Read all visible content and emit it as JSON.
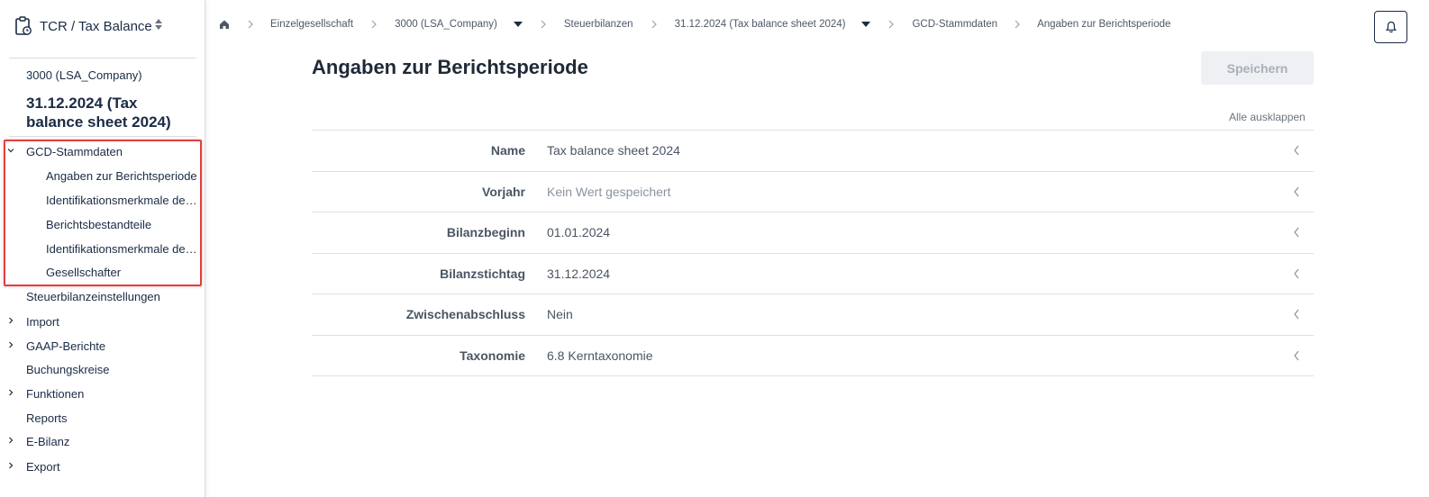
{
  "app": {
    "title": "TCR / Tax Balance"
  },
  "sidebar": {
    "company": "3000 (LSA_Company)",
    "period": "31.12.2024 (Tax balance sheet 2024)",
    "items": [
      {
        "label": "GCD-Stammdaten",
        "expanded": true
      },
      {
        "label": "Angaben zur Berichtsperiode",
        "sub": true
      },
      {
        "label": "Identifikationsmerkmale des Berichts",
        "sub": true
      },
      {
        "label": "Berichtsbestandteile",
        "sub": true
      },
      {
        "label": "Identifikationsmerkmale des Unternehmens",
        "sub": true
      },
      {
        "label": "Gesellschafter",
        "sub": true
      },
      {
        "label": "Steuerbilanzeinstellungen"
      },
      {
        "label": "Import",
        "collapsed": true
      },
      {
        "label": "GAAP-Berichte",
        "collapsed": true
      },
      {
        "label": "Buchungskreise"
      },
      {
        "label": "Funktionen",
        "collapsed": true
      },
      {
        "label": "Reports"
      },
      {
        "label": "E-Bilanz",
        "collapsed": true
      },
      {
        "label": "Export",
        "collapsed": true
      }
    ],
    "highlight_color": "#e04040"
  },
  "breadcrumb": [
    "Einzelgesellschaft",
    "3000 (LSA_Company)",
    "Steuerbilanzen",
    "31.12.2024 (Tax balance sheet 2024)",
    "GCD-Stammdaten",
    "Angaben zur Berichtsperiode"
  ],
  "main": {
    "title": "Angaben zur Berichtsperiode",
    "save_label": "Speichern",
    "expand_all": "Alle ausklappen",
    "rows": [
      {
        "label": "Name",
        "value": "Tax balance sheet 2024"
      },
      {
        "label": "Vorjahr",
        "value": "Kein Wert gespeichert"
      },
      {
        "label": "Bilanzbeginn",
        "value": "01.01.2024"
      },
      {
        "label": "Bilanzstichtag",
        "value": "31.12.2024"
      },
      {
        "label": "Zwischenabschluss",
        "value": "Nein"
      },
      {
        "label": "Taxonomie",
        "value": "6.8 Kerntaxonomie"
      }
    ]
  },
  "icons": {
    "app": "clipboard-clock-icon",
    "sort": "sort-icon",
    "home": "home-icon",
    "bell": "bell-icon"
  }
}
